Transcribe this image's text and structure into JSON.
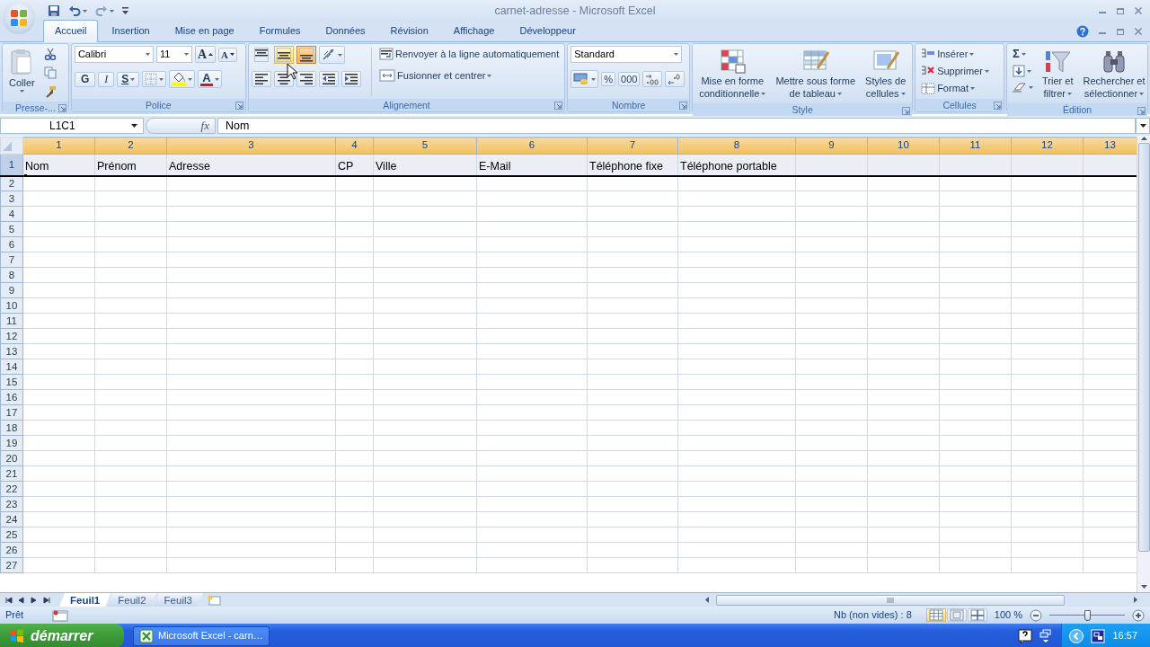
{
  "window": {
    "title": "carnet-adresse - Microsoft Excel"
  },
  "tabs": [
    {
      "label": "Accueil",
      "selected": true
    },
    {
      "label": "Insertion",
      "selected": false
    },
    {
      "label": "Mise en page",
      "selected": false
    },
    {
      "label": "Formules",
      "selected": false
    },
    {
      "label": "Données",
      "selected": false
    },
    {
      "label": "Révision",
      "selected": false
    },
    {
      "label": "Affichage",
      "selected": false
    },
    {
      "label": "Développeur",
      "selected": false
    }
  ],
  "ribbon": {
    "clipboard": {
      "paste": "Coller",
      "label": "Presse-..."
    },
    "font": {
      "name": "Calibri",
      "size": "11",
      "grow": "A",
      "shrink": "A",
      "bold": "G",
      "italic": "I",
      "underline": "S",
      "font_color_button": "A",
      "label": "Police"
    },
    "alignment": {
      "vertical": [
        {
          "kind": "top",
          "selected": false,
          "hovered": false
        },
        {
          "kind": "middle",
          "selected": false,
          "hovered": true
        },
        {
          "kind": "bottom",
          "selected": true,
          "hovered": false
        }
      ],
      "horizontal": [
        {
          "kind": "left"
        },
        {
          "kind": "center"
        },
        {
          "kind": "right"
        }
      ],
      "wrap": "Renvoyer à la ligne automatiquement",
      "merge": "Fusionner et centrer",
      "label": "Alignement"
    },
    "number": {
      "format": "Standard",
      "percent": "%",
      "thousands": "000",
      "label": "Nombre"
    },
    "style": {
      "buttons": [
        {
          "lines": [
            "Mise en forme",
            "conditionnelle"
          ]
        },
        {
          "lines": [
            "Mettre sous forme",
            "de tableau"
          ]
        },
        {
          "lines": [
            "Styles de",
            "cellules"
          ]
        }
      ],
      "label": "Style"
    },
    "cells": {
      "buttons": [
        "Insérer",
        "Supprimer",
        "Format"
      ],
      "label": "Cellules"
    },
    "editing": {
      "sum": "Σ",
      "buttons": [
        {
          "lines": [
            "Trier et",
            "filtrer"
          ]
        },
        {
          "lines": [
            "Rechercher et",
            "sélectionner"
          ]
        }
      ],
      "label": "Édition"
    }
  },
  "formula_bar": {
    "name_box": "L1C1",
    "function_label": "fx",
    "content": "Nom"
  },
  "sheet": {
    "columns": [
      "1",
      "2",
      "3",
      "4",
      "5",
      "6",
      "7",
      "8",
      "9",
      "10",
      "11",
      "12",
      "13"
    ],
    "rows": [
      {
        "header": "1",
        "selected": true,
        "cells": [
          "Nom",
          "Prénom",
          "Adresse",
          "CP",
          "Ville",
          "E-Mail",
          "Téléphone fixe",
          "Téléphone portable"
        ]
      },
      {
        "header": "2",
        "selected": false
      },
      {
        "header": "3",
        "selected": false
      },
      {
        "header": "4",
        "selected": false
      },
      {
        "header": "5",
        "selected": false
      },
      {
        "header": "6",
        "selected": false
      },
      {
        "header": "7",
        "selected": false
      },
      {
        "header": "8",
        "selected": false
      },
      {
        "header": "9",
        "selected": false
      },
      {
        "header": "10",
        "selected": false
      },
      {
        "header": "11",
        "selected": false
      },
      {
        "header": "12",
        "selected": false
      },
      {
        "header": "13",
        "selected": false
      },
      {
        "header": "14",
        "selected": false
      },
      {
        "header": "15",
        "selected": false
      },
      {
        "header": "16",
        "selected": false
      },
      {
        "header": "17",
        "selected": false
      },
      {
        "header": "18",
        "selected": false
      },
      {
        "header": "19",
        "selected": false
      },
      {
        "header": "20",
        "selected": false
      },
      {
        "header": "21",
        "selected": false
      },
      {
        "header": "22",
        "selected": false
      },
      {
        "header": "23",
        "selected": false
      },
      {
        "header": "24",
        "selected": false
      },
      {
        "header": "25",
        "selected": false
      },
      {
        "header": "26",
        "selected": false
      },
      {
        "header": "27",
        "selected": false
      }
    ]
  },
  "sheet_tabs": [
    {
      "label": "Feuil1",
      "selected": true
    },
    {
      "label": "Feuil2",
      "selected": false
    },
    {
      "label": "Feuil3",
      "selected": false
    }
  ],
  "status_bar": {
    "mode": "Prêt",
    "count": "Nb (non vides) : 8",
    "views": [
      {
        "kind": "normal",
        "selected": true
      },
      {
        "kind": "page_layout",
        "selected": false
      },
      {
        "kind": "page_break",
        "selected": false
      }
    ],
    "zoom": "100 %",
    "zoom_slider": {
      "level": 0.5
    }
  },
  "taskbar": {
    "start": "démarrer",
    "task": "Microsoft Excel - carn…",
    "clock": "16:57"
  }
}
